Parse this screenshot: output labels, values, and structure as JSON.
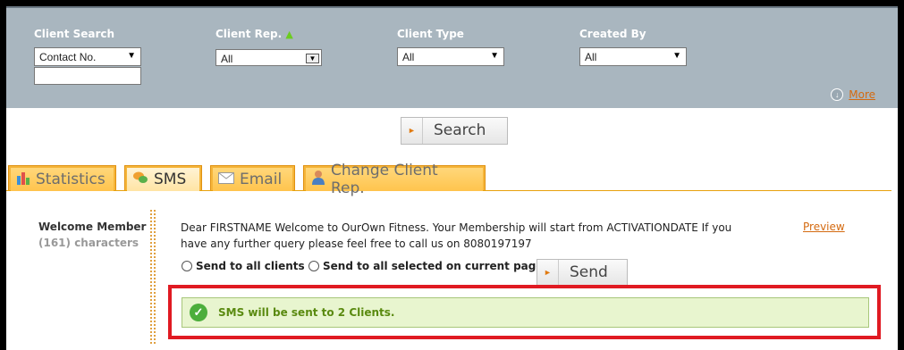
{
  "filters": {
    "client_search": {
      "label": "Client Search",
      "value": "Contact No.",
      "text_value": ""
    },
    "client_rep": {
      "label": "Client Rep.",
      "value": "All"
    },
    "client_type": {
      "label": "Client Type",
      "value": "All"
    },
    "created_by": {
      "label": "Created By",
      "value": "All"
    },
    "more_label": "More"
  },
  "search_button": "Search",
  "tabs": [
    {
      "label": "Statistics",
      "icon": "bar-chart-icon"
    },
    {
      "label": "SMS",
      "icon": "chat-bubbles-icon"
    },
    {
      "label": "Email",
      "icon": "envelope-icon"
    },
    {
      "label": "Change Client Rep.",
      "icon": "person-icon"
    }
  ],
  "active_tab": "SMS",
  "sms": {
    "template_name": "Welcome Member",
    "char_count": "(161) characters",
    "message": "Dear FIRSTNAME Welcome to OurOwn Fitness. Your Membership will start from ACTIVATIONDATE If you have any further query please feel free to call us on  8080197197",
    "preview_label": "Preview",
    "radio_all": "Send to all clients",
    "radio_selected": "Send to all selected on current page",
    "send_button": "Send",
    "success_message": "SMS will be sent to 2 Clients."
  },
  "colors": {
    "filter_bg": "#a9b6bf",
    "tab_orange": "#f5b53a",
    "link_orange": "#d46a10",
    "highlight_red": "#e01a22",
    "success_green": "#4cae3c"
  }
}
